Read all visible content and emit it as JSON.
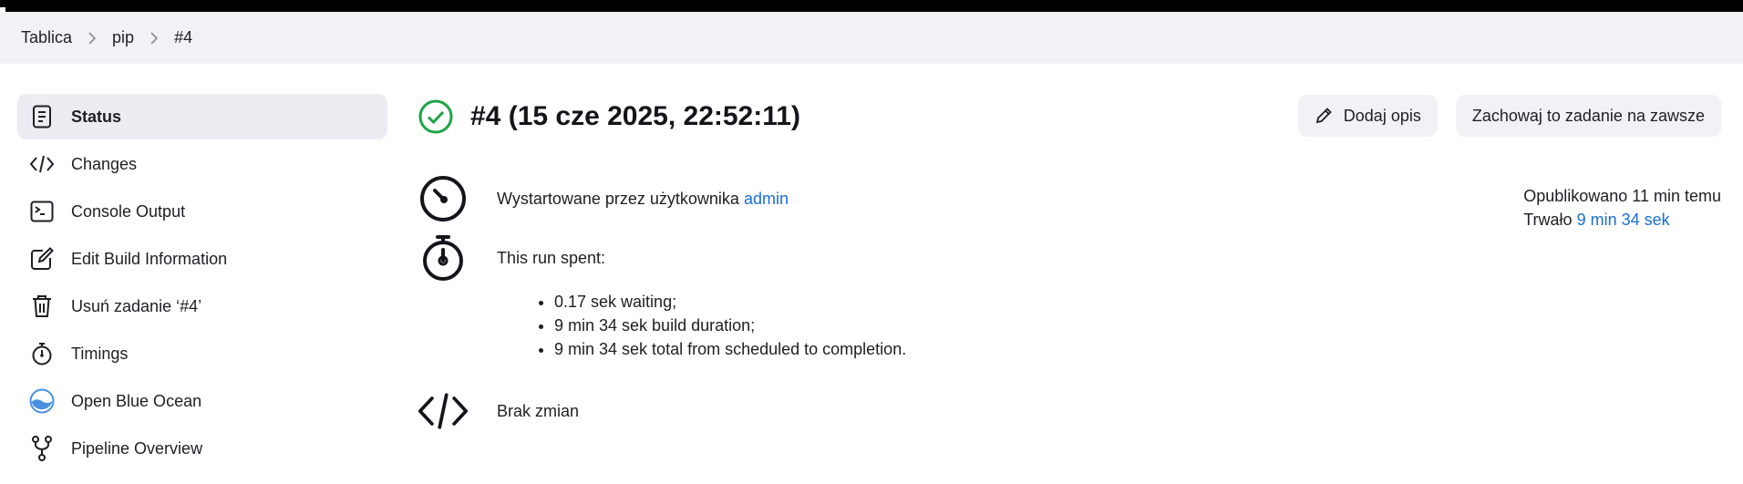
{
  "breadcrumb": {
    "items": [
      "Tablica",
      "pip",
      "#4"
    ]
  },
  "sidebar": {
    "items": [
      {
        "label": "Status",
        "icon": "document-icon",
        "active": true
      },
      {
        "label": "Changes",
        "icon": "code-icon"
      },
      {
        "label": "Console Output",
        "icon": "terminal-icon"
      },
      {
        "label": "Edit Build Information",
        "icon": "edit-icon"
      },
      {
        "label": "Usuń zadanie ‘#4’",
        "icon": "trash-icon"
      },
      {
        "label": "Timings",
        "icon": "stopwatch-icon"
      },
      {
        "label": "Open Blue Ocean",
        "icon": "blue-ocean-icon"
      },
      {
        "label": "Pipeline Overview",
        "icon": "pipeline-icon"
      }
    ]
  },
  "build": {
    "title": "#4 (15 cze 2025, 22:52:11)",
    "status_icon": "success-check-icon",
    "status_color": "#1ea446"
  },
  "actions": {
    "add_description": "Dodaj opis",
    "keep_forever": "Zachowaj to zadanie na zawsze"
  },
  "started": {
    "prefix": "Wystartowane przez użytkownika",
    "user": "admin"
  },
  "meta": {
    "published": "Opublikowano 11 min temu",
    "duration_label": "Trwało",
    "duration_value": "9 min 34 sek"
  },
  "spent": {
    "heading": "This run spent:",
    "items": [
      "0.17 sek waiting;",
      "9 min 34 sek build duration;",
      "9 min 34 sek total from scheduled to completion."
    ]
  },
  "changes": {
    "text": "Brak zmian"
  },
  "colors": {
    "link": "#1c6ed6",
    "accent_bg": "#ececf3"
  }
}
